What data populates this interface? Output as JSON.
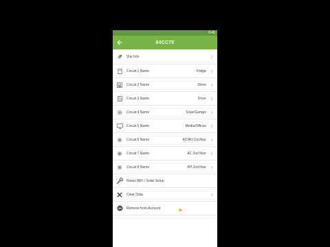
{
  "status": {
    "time": "6:40"
  },
  "header": {
    "title": "04CC70"
  },
  "rows": [
    {
      "label": "Vue Info",
      "value": "",
      "icon": "leaf-icon"
    },
    {
      "label": "Circuit 1 Name",
      "value": "Fridge",
      "icon": "fridge-icon"
    },
    {
      "label": "Circuit 2 Name",
      "value": "Stove",
      "icon": "stove-icon"
    },
    {
      "label": "Circuit 3 Name",
      "value": "Dryer",
      "icon": "dryer-icon"
    },
    {
      "label": "Circuit 4 Name",
      "value": "Solar/Garage",
      "icon": "gear-icon"
    },
    {
      "label": "Circuit 5 Name",
      "value": "Media/Offices",
      "icon": "monitor-icon"
    },
    {
      "label": "Circuit 6 Name",
      "value": "AC/AH 1st floor",
      "icon": "snowflake-icon"
    },
    {
      "label": "Circuit 7 Name",
      "value": "AC 2nd floor",
      "icon": "snowflake-icon"
    },
    {
      "label": "Circuit 8 Name",
      "value": "AH 2nd floor",
      "icon": "snowflake-icon"
    },
    {
      "label": "Reset WiFi / Solar Setup",
      "value": "",
      "icon": "wrench-icon"
    },
    {
      "label": "Clear Data",
      "value": "",
      "icon": "close-icon"
    },
    {
      "label": "Remove from Account",
      "value": "",
      "icon": "minus-circle-icon"
    }
  ],
  "colors": {
    "appbar": "#79b545",
    "statusbar": "#5f9a3c",
    "chevron": "#bdbdbd",
    "cursor": "#f5a623"
  }
}
